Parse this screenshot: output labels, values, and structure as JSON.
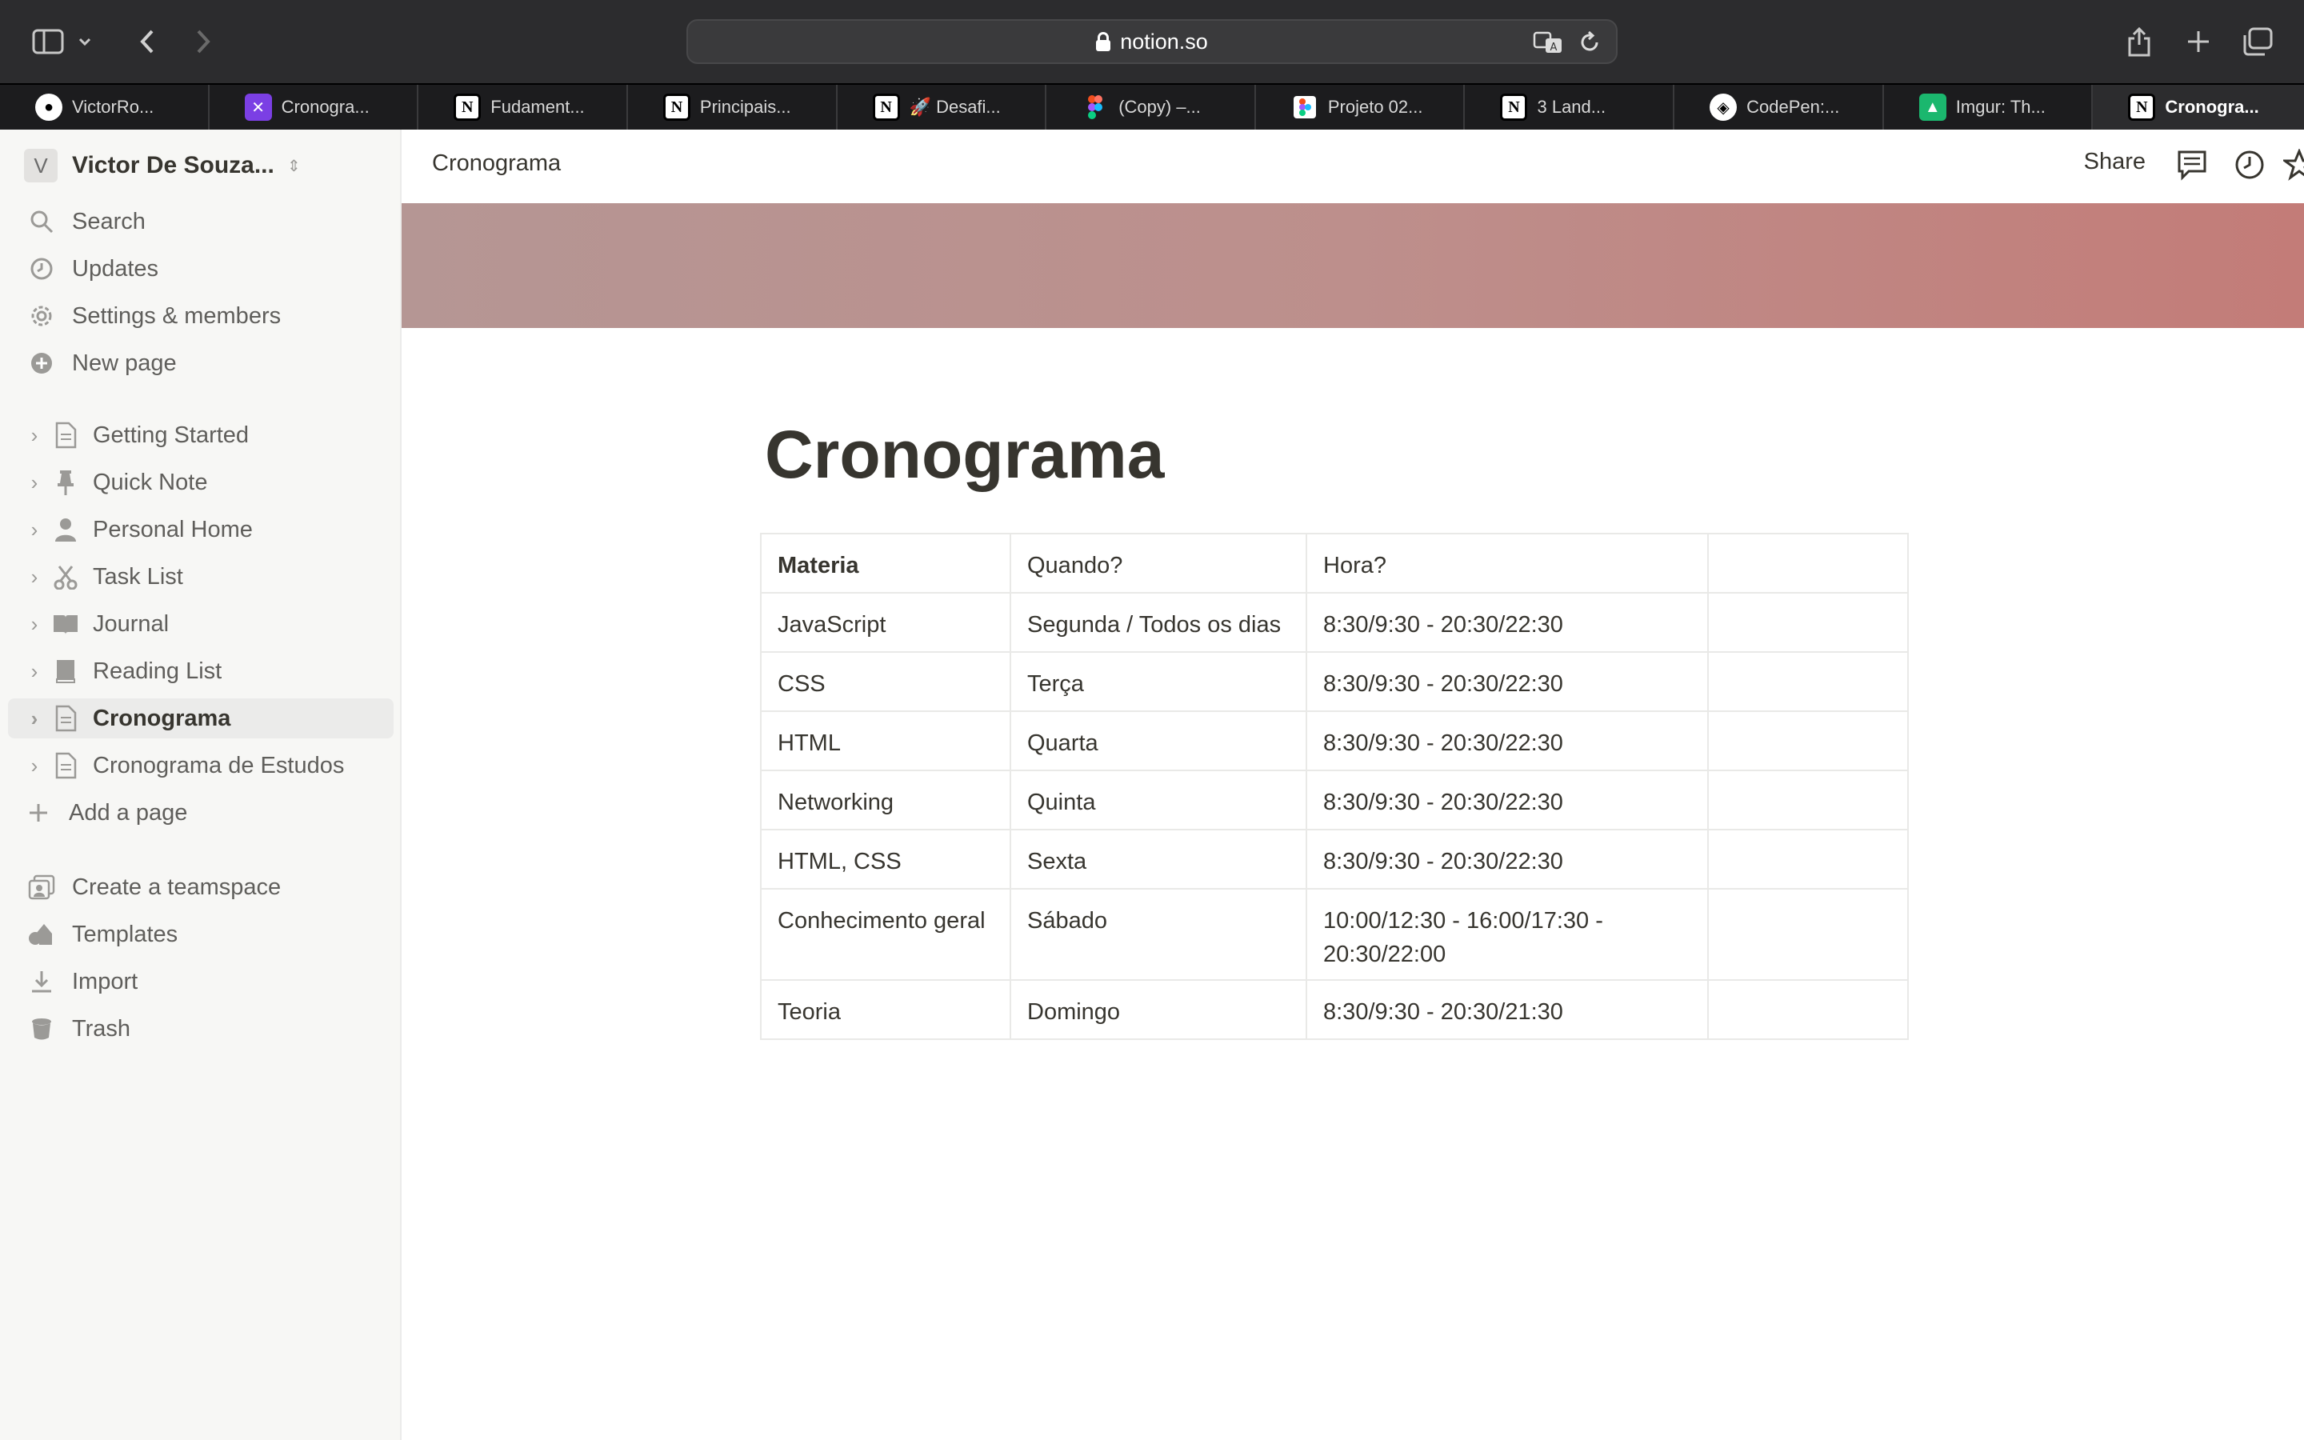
{
  "browser": {
    "url": "notion.so",
    "tabs": [
      {
        "label": "VictorRo...",
        "icon": "github-icon"
      },
      {
        "label": "Cronogra...",
        "icon": "app-icon"
      },
      {
        "label": "Fudament...",
        "icon": "notion-icon"
      },
      {
        "label": "Principais...",
        "icon": "notion-icon"
      },
      {
        "label": "🚀 Desafi...",
        "icon": "notion-icon"
      },
      {
        "label": "(Copy) –...",
        "icon": "figma-icon"
      },
      {
        "label": "Projeto 02...",
        "icon": "figma-icon"
      },
      {
        "label": "3 Land...",
        "icon": "notion-icon"
      },
      {
        "label": "CodePen:...",
        "icon": "codepen-icon"
      },
      {
        "label": "Imgur: Th...",
        "icon": "imgur-icon"
      },
      {
        "label": "Cronogra...",
        "icon": "notion-icon",
        "active": true
      }
    ]
  },
  "sidebar": {
    "workspace_initial": "V",
    "workspace_name": "Victor De Souza...",
    "top_items": [
      {
        "label": "Search",
        "icon": "search-icon"
      },
      {
        "label": "Updates",
        "icon": "clock-icon"
      },
      {
        "label": "Settings & members",
        "icon": "gear-icon"
      },
      {
        "label": "New page",
        "icon": "plus-circle-icon"
      }
    ],
    "pages": [
      {
        "label": "Getting Started",
        "icon": "document-icon"
      },
      {
        "label": "Quick Note",
        "icon": "pin-icon"
      },
      {
        "label": "Personal Home",
        "icon": "person-icon"
      },
      {
        "label": "Task List",
        "icon": "scissors-icon"
      },
      {
        "label": "Journal",
        "icon": "book-open-icon"
      },
      {
        "label": "Reading List",
        "icon": "book-icon"
      },
      {
        "label": "Cronograma",
        "icon": "document-icon",
        "active": true
      },
      {
        "label": "Cronograma de Estudos",
        "icon": "document-icon"
      }
    ],
    "add_page": "Add a page",
    "bottom_items": [
      {
        "label": "Create a teamspace",
        "icon": "teamspace-icon"
      },
      {
        "label": "Templates",
        "icon": "templates-icon"
      },
      {
        "label": "Import",
        "icon": "download-icon"
      },
      {
        "label": "Trash",
        "icon": "trash-icon"
      }
    ]
  },
  "topbar": {
    "breadcrumb": "Cronograma",
    "share_label": "Share"
  },
  "page": {
    "title": "Cronograma",
    "table": {
      "headers": [
        "Materia",
        "Quando?",
        "Hora?",
        ""
      ],
      "rows": [
        [
          "JavaScript",
          "Segunda / Todos os dias",
          "8:30/9:30 - 20:30/22:30",
          ""
        ],
        [
          "CSS",
          "Terça",
          "8:30/9:30 - 20:30/22:30",
          ""
        ],
        [
          "HTML",
          "Quarta",
          "8:30/9:30 - 20:30/22:30",
          ""
        ],
        [
          "Networking",
          "Quinta",
          "8:30/9:30 - 20:30/22:30",
          ""
        ],
        [
          "HTML, CSS",
          "Sexta",
          "8:30/9:30 - 20:30/22:30",
          ""
        ],
        [
          "Conhecimento geral",
          "Sábado",
          "10:00/12:30 - 16:00/17:30 - 20:30/22:00",
          ""
        ],
        [
          "Teoria",
          "Domingo",
          "8:30/9:30 - 20:30/21:30",
          ""
        ]
      ]
    }
  }
}
